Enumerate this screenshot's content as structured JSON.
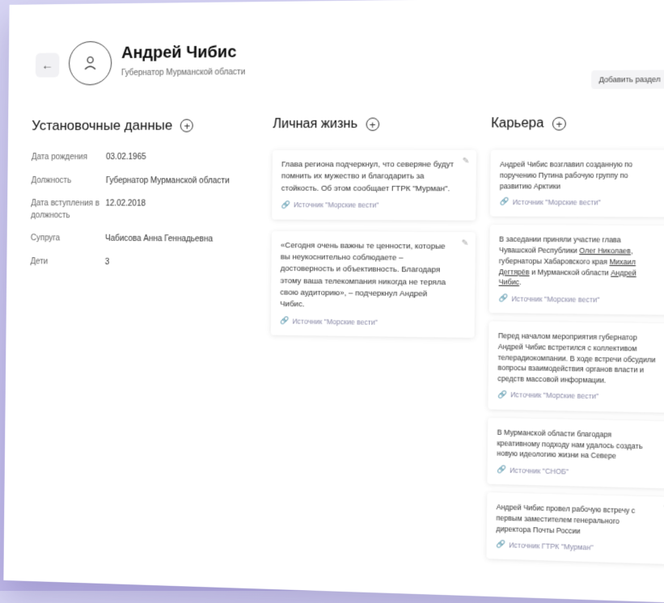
{
  "header": {
    "name": "Андрей Чибис",
    "subtitle": "Губернатор Мурманской области",
    "add_section_label": "Добавить раздел",
    "back_glyph": "←"
  },
  "sections": {
    "basic": {
      "title": "Установочные данные"
    },
    "personal": {
      "title": "Личная жизнь"
    },
    "career": {
      "title": "Карьера"
    }
  },
  "facts": [
    {
      "label": "Дата рождения",
      "value": "03.02.1965"
    },
    {
      "label": "Должность",
      "value": "Губернатор Мурманской области"
    },
    {
      "label": "Дата вступления в должность",
      "value": "12.02.2018"
    },
    {
      "label": "Супруга",
      "value": "Чабисова Анна Геннадьевна"
    },
    {
      "label": "Дети",
      "value": "3"
    }
  ],
  "personal_cards": [
    {
      "text": "Глава региона подчеркнул, что северяне будут помнить их мужество и благодарить за стойкость. Об этом сообщает ГТРК \"Мурман\".",
      "source": "Источник \"Морские вести\""
    },
    {
      "text": "«Сегодня очень важны те ценности, которые вы неукоснительно соблюдаете – достоверность и объективность. Благодаря этому ваша телекомпания никогда не теряла свою аудиторию», – подчеркнул Андрей Чибис.",
      "source": "Источник \"Морские вести\""
    }
  ],
  "career_cards": [
    {
      "text": "Андрей Чибис возглавил созданную по поручению Путина рабочую группу по развитию Арктики",
      "source": "Источник \"Морские вести\""
    },
    {
      "text_parts": [
        "В заседании приняли участие глава Чувашской Республики ",
        "Олег Николаев",
        ", губернаторы Хабаровского края ",
        "Михаил Дегтярёв",
        " и Мурманской области ",
        "Андрей Чибис",
        "."
      ],
      "source": "Источник \"Морские вести\""
    },
    {
      "text": "Перед началом мероприятия губернатор Андрей Чибис встретился с коллективом телерадиокомпании. В ходе встречи обсудили вопросы взаимодействия органов власти и средств массовой информации.",
      "source": "Источник \"Морские вести\""
    },
    {
      "text": "В Мурманской области благодаря креативному подходу нам удалось создать новую идеологию жизни на Севере",
      "source": "Источник \"СНОБ\""
    },
    {
      "text": "Андрей Чибис провел рабочую встречу с первым заместителем генерального директора Почты России",
      "source": "Источник ГТРК \"Мурман\""
    }
  ]
}
